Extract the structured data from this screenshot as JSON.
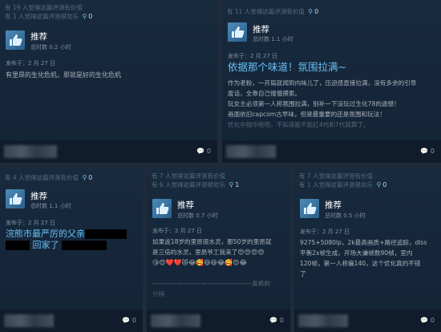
{
  "cards": [
    {
      "votes": "有 19 人觉得这篇评测有价值",
      "funny": "有 1 人觉得这篇评测很欢乐",
      "awards": "0",
      "rec_label": "推荐",
      "hours": "总时数 0.2 小时",
      "posted": "发布于：2 月 27 日",
      "body": "有里昂的生化危机，那就是好的生化危机",
      "comments": "0"
    },
    {
      "votes": "有 11 人觉得这篇评测有价值",
      "awards": "0",
      "rec_label": "推荐",
      "hours": "总时数 1.1 小时",
      "posted": "发布于：2 月 27 日",
      "headline": "依据那个味道！氛围拉满~",
      "body_lines": [
        "作为老粉，一开局就闻到内味儿了，压迫感直接拉满，没有多余的引导",
        "废话，全靠自己慢慢摸索。",
        "玩女主必须第一人称氛围拉满，别补一下没玩过生化78的遗憾！",
        "画面依旧capcom古早味，但是最重要的还是氛围和玩法！",
        "优化中规中矩吧，不知道能不能扛4代和7代就算了。"
      ],
      "comments": "0"
    },
    {
      "votes": "有 4 人觉得这篇评测有价值",
      "awards": "0",
      "rec_label": "推荐",
      "hours": "总时数 1.1 小时",
      "posted": "发布于：2 月 27 日",
      "body_part1": "浣熊市最严厉的父亲",
      "body_part2": "回家了",
      "comments": "0"
    },
    {
      "votes": "有 7 人觉得这篇评测有价值",
      "funny": "有 6 人觉得这篇评测很欢乐",
      "awards": "1",
      "rec_label": "推荐",
      "hours": "总时数 0.7 小时",
      "posted": "发布于：2 月 27 日",
      "body_line1": "如果说18岁的里昂很水灵，那50岁的里昂就",
      "body_line2": "是三倍的水灵，里昂爷工我来了",
      "emoji_line2": "😍😍😍😍",
      "emoji_line3": "😘😍❤️❤️😻😂🥰😄😆😂🥰😍😂",
      "dashes": "————————————————-发疯的",
      "body_tail": "分隔",
      "comments": "0"
    },
    {
      "votes": "有 7 人觉得这篇评测有价值",
      "funny": "有 1 人觉得这篇评测很欢乐",
      "awards": "0",
      "rec_label": "推荐",
      "hours": "总时数 0.5 小时",
      "posted": "发布于：2 月 27 日",
      "body_lines": [
        "9275+5080lp，2k最高画质+路径追踪，dlss",
        "平衡2x帧生成，开场大谦帧数90帧，室内",
        "120帧，第一人称偏140，这个优化真的不错",
        "了"
      ],
      "comments": "0"
    }
  ]
}
